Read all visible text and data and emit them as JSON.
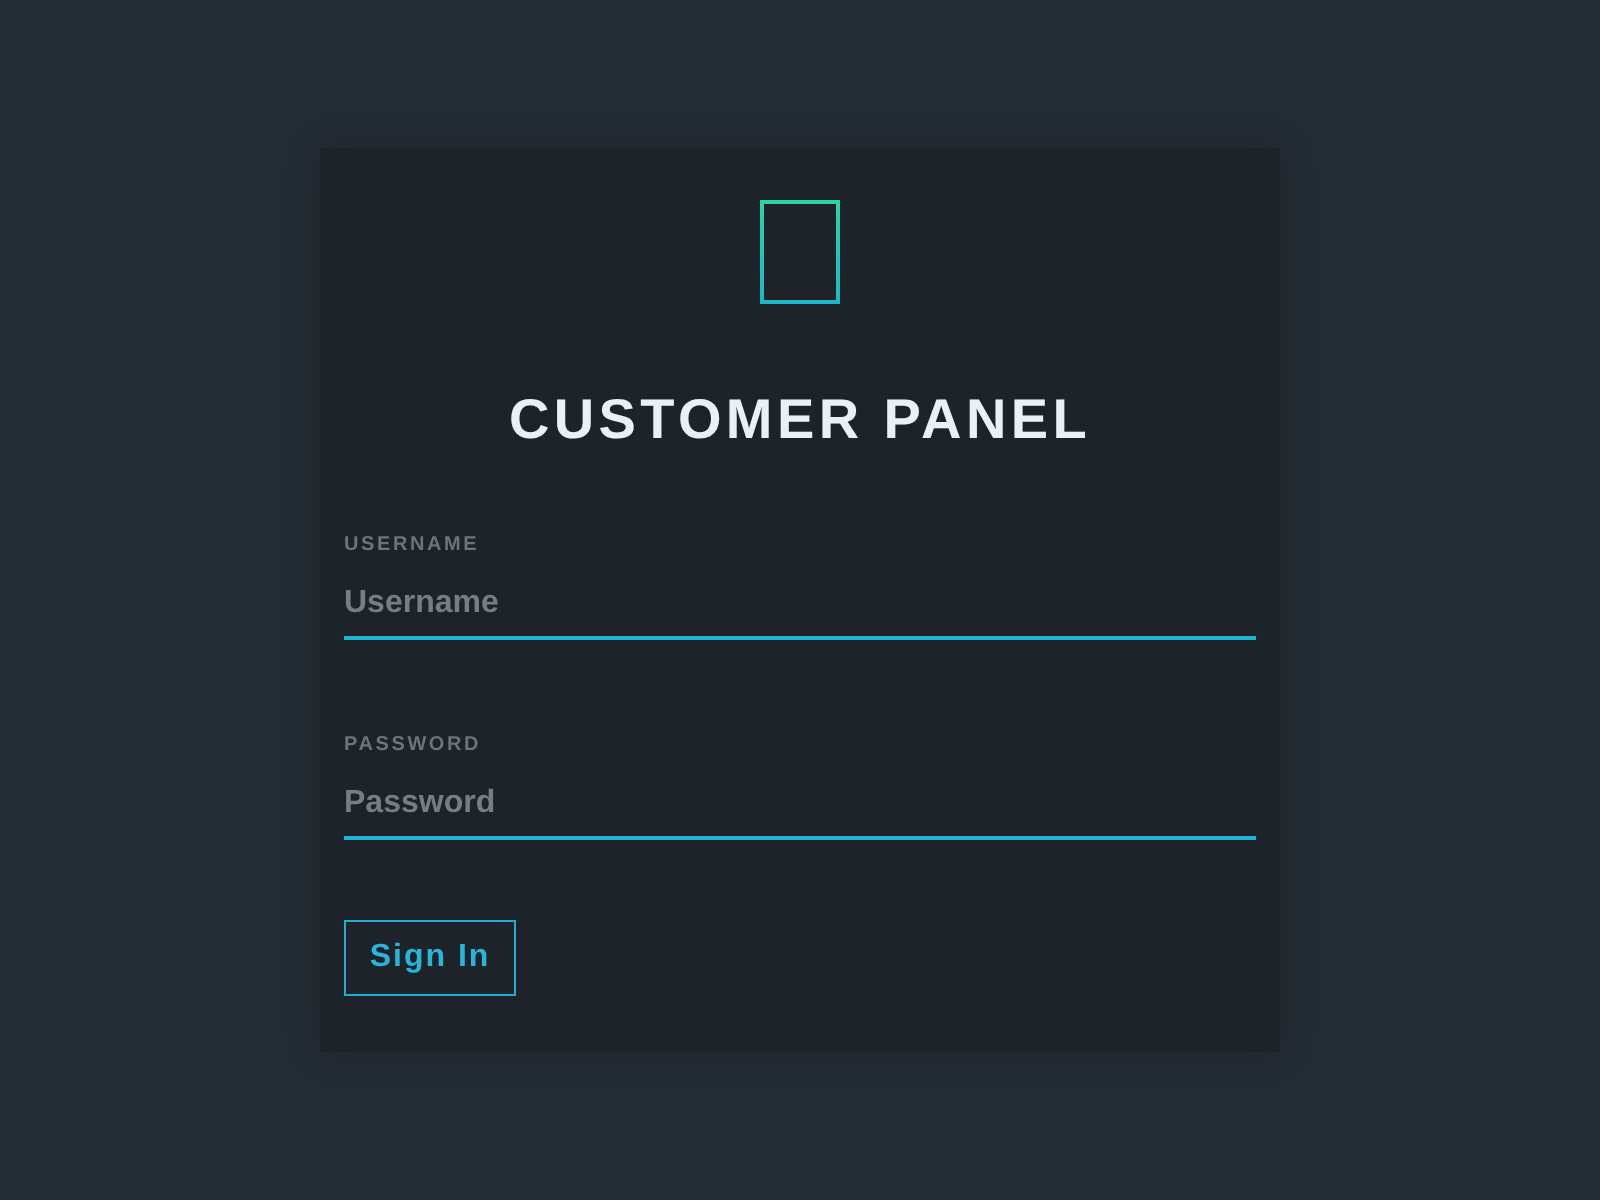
{
  "title": "CUSTOMER PANEL",
  "fields": [
    {
      "label": "USERNAME",
      "placeholder": "Username"
    },
    {
      "label": "PASSWORD",
      "placeholder": "Password"
    }
  ],
  "button": {
    "label": "Sign In"
  }
}
